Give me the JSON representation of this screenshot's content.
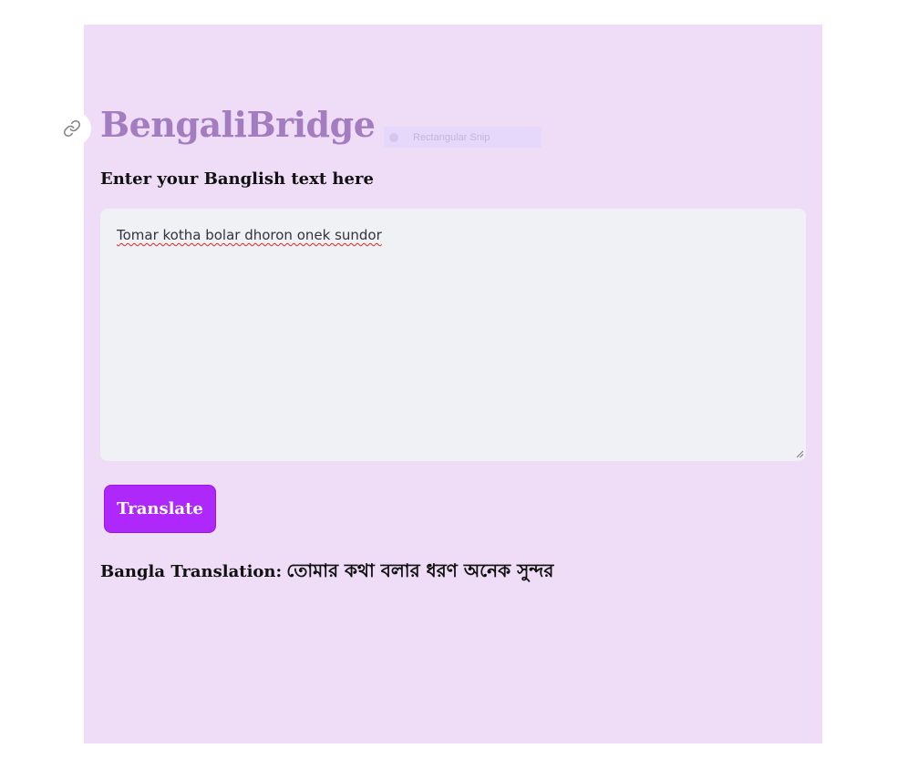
{
  "app": {
    "title": "BengaliBridge"
  },
  "overlay": {
    "snip_label": "Rectangular Snip"
  },
  "form": {
    "input_label": "Enter your Banglish text here",
    "input_value": "Tomar kotha bolar dhoron onek sundor",
    "button_label": "Translate"
  },
  "result": {
    "label": "Bangla Translation:",
    "value": "তোমার কথা বলার ধরণ অনেক সুন্দর"
  },
  "icons": {
    "anchor": "link-icon",
    "snip": "snip-icon",
    "resize": "resize-grip-icon"
  },
  "colors": {
    "panel_background": "#efdcf6",
    "title": "#a37dc0",
    "input_background": "#f0f1f5",
    "button": "#ae27fb",
    "button_text": "#ffffff",
    "spellcheck": "#e02424"
  }
}
